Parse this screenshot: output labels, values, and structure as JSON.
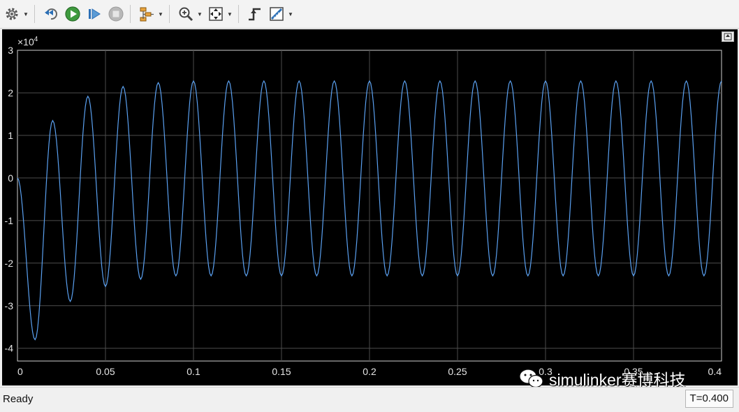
{
  "toolbar": {
    "buttons": [
      {
        "icon": "gear-icon",
        "dropdown": true
      },
      {
        "icon": "step-back-icon"
      },
      {
        "icon": "run-icon"
      },
      {
        "icon": "step-forward-icon"
      },
      {
        "icon": "stop-icon"
      },
      {
        "icon": "signal-hierarchy-icon",
        "dropdown": true
      },
      {
        "icon": "zoom-in-icon",
        "dropdown": true
      },
      {
        "icon": "fit-to-view-icon",
        "dropdown": true
      },
      {
        "icon": "triggers-icon"
      },
      {
        "icon": "cursor-measurements-icon",
        "dropdown": true
      }
    ]
  },
  "status": {
    "text": "Ready",
    "time": "T=0.400"
  },
  "watermark": {
    "text": "simulinker赛博科技"
  },
  "colors": {
    "plot_background": "#000000",
    "signal": "#5aa0f0",
    "grid": "#4d4d4d",
    "tick_label": "#e6e6e6"
  },
  "chart_data": {
    "type": "line",
    "x_ticks": [
      "0",
      "0.05",
      "0.1",
      "0.15",
      "0.2",
      "0.25",
      "0.3",
      "0.35",
      "0.4"
    ],
    "y_ticks": [
      "3",
      "2",
      "1",
      "0",
      "-1",
      "-2",
      "-3",
      "-4"
    ],
    "y_exponent_label": "×10",
    "y_exponent_power": "4",
    "xlim": [
      0,
      0.4
    ],
    "ylim": [
      -4.3,
      3.0
    ],
    "grid": true,
    "series": [
      {
        "signal_frequency_hz": 50,
        "x": [
          0,
          0.01,
          0.02,
          0.03,
          0.04,
          0.05,
          0.06,
          0.07,
          0.08,
          0.09,
          0.1,
          0.11,
          0.12,
          0.13,
          0.14,
          0.15,
          0.16,
          0.17,
          0.18,
          0.19,
          0.2,
          0.21,
          0.22,
          0.23,
          0.24,
          0.25,
          0.26,
          0.27,
          0.28,
          0.29,
          0.3,
          0.31,
          0.32,
          0.33,
          0.34,
          0.35,
          0.36,
          0.37,
          0.38,
          0.39,
          0.4
        ],
        "extrema": [
          0,
          -3.8,
          1.35,
          -2.9,
          1.92,
          -2.55,
          2.15,
          -2.38,
          2.24,
          -2.3,
          2.28,
          -2.3,
          2.28,
          -2.3,
          2.28,
          -2.3,
          2.28,
          -2.3,
          2.28,
          -2.3,
          2.28,
          -2.3,
          2.28,
          -2.3,
          2.28,
          -2.3,
          2.28,
          -2.3,
          2.28,
          -2.3,
          2.28,
          -2.3,
          2.28,
          -2.3,
          2.28,
          -2.3,
          2.28,
          -2.3,
          2.28,
          -2.3,
          2.28
        ]
      }
    ]
  }
}
